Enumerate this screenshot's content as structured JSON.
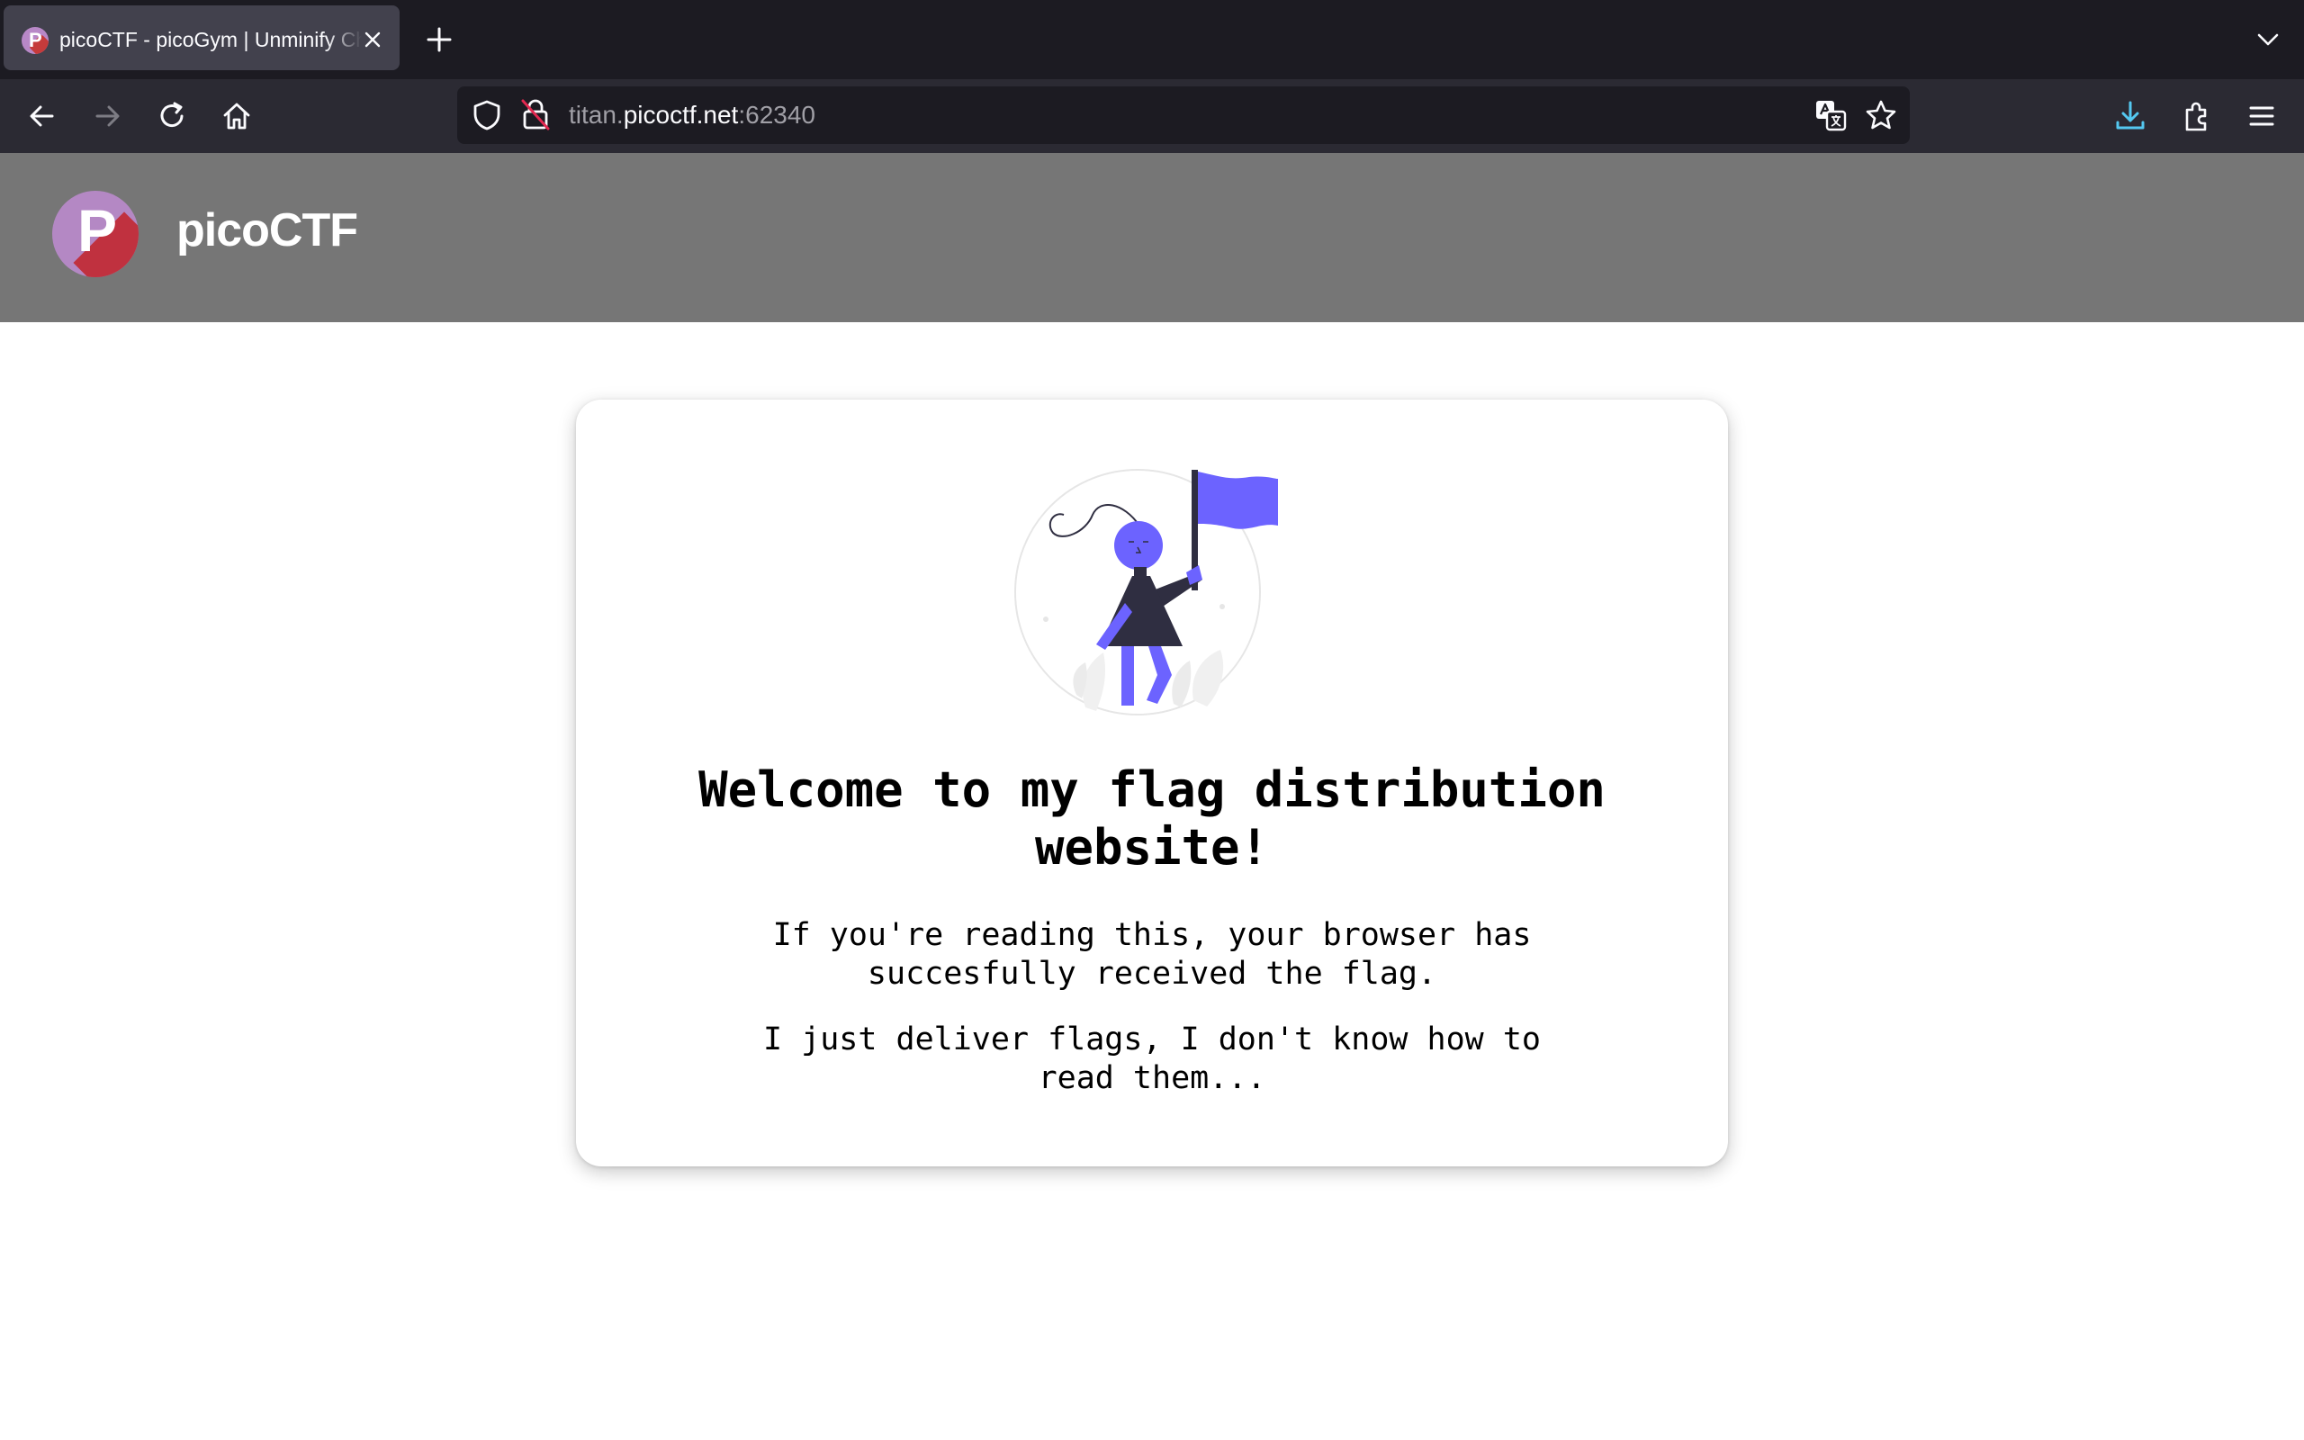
{
  "browser": {
    "tab": {
      "title": "picoCTF - picoGym | Unminify Challenge",
      "favicon_letter": "P"
    },
    "url": {
      "prefix": "titan.",
      "domain": "picoctf.net",
      "port": ":62340"
    }
  },
  "site": {
    "brand": "picoCTF",
    "logo_letter": "P"
  },
  "card": {
    "heading": "Welcome to my flag distribution website!",
    "line1": "If you're reading this, your browser has succesfully received the flag.",
    "line2": "I just deliver flags, I don't know how to read them..."
  },
  "colors": {
    "accent": "#6c63ff",
    "header_bg": "#767676",
    "dark": "#2f2e41"
  }
}
